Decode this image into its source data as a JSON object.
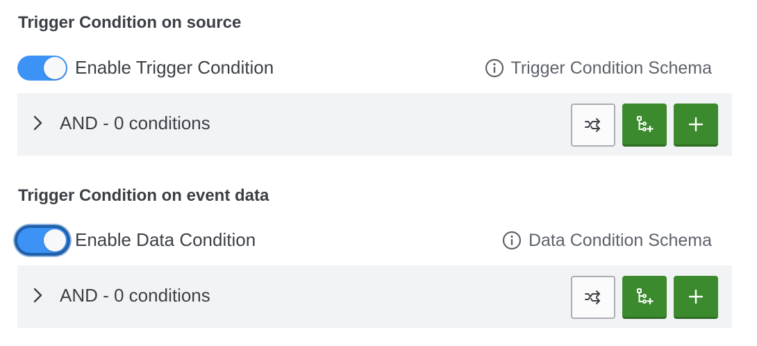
{
  "sections": [
    {
      "title": "Trigger Condition on source",
      "toggle": {
        "label": "Enable Trigger Condition",
        "enabled": true,
        "focused": false
      },
      "schema_link": {
        "label": "Trigger Condition Schema",
        "icon": "info-icon"
      },
      "conditions": {
        "label": "AND - 0 conditions"
      },
      "buttons": [
        {
          "name": "swap-button",
          "icon": "shuffle-icon"
        },
        {
          "name": "add-group-button",
          "icon": "tree-add-icon"
        },
        {
          "name": "add-condition-button",
          "icon": "plus-icon"
        }
      ]
    },
    {
      "title": "Trigger Condition on event data",
      "toggle": {
        "label": "Enable Data Condition",
        "enabled": true,
        "focused": true
      },
      "schema_link": {
        "label": "Data Condition Schema",
        "icon": "info-icon"
      },
      "conditions": {
        "label": "AND - 0 conditions"
      },
      "buttons": [
        {
          "name": "swap-button",
          "icon": "shuffle-icon"
        },
        {
          "name": "add-group-button",
          "icon": "tree-add-icon"
        },
        {
          "name": "add-condition-button",
          "icon": "plus-icon"
        }
      ]
    }
  ],
  "colors": {
    "toggle_on": "#3d92f6",
    "button_green": "#3c8a2e",
    "panel_bg": "#f2f3f5",
    "text": "#3b3f45"
  }
}
